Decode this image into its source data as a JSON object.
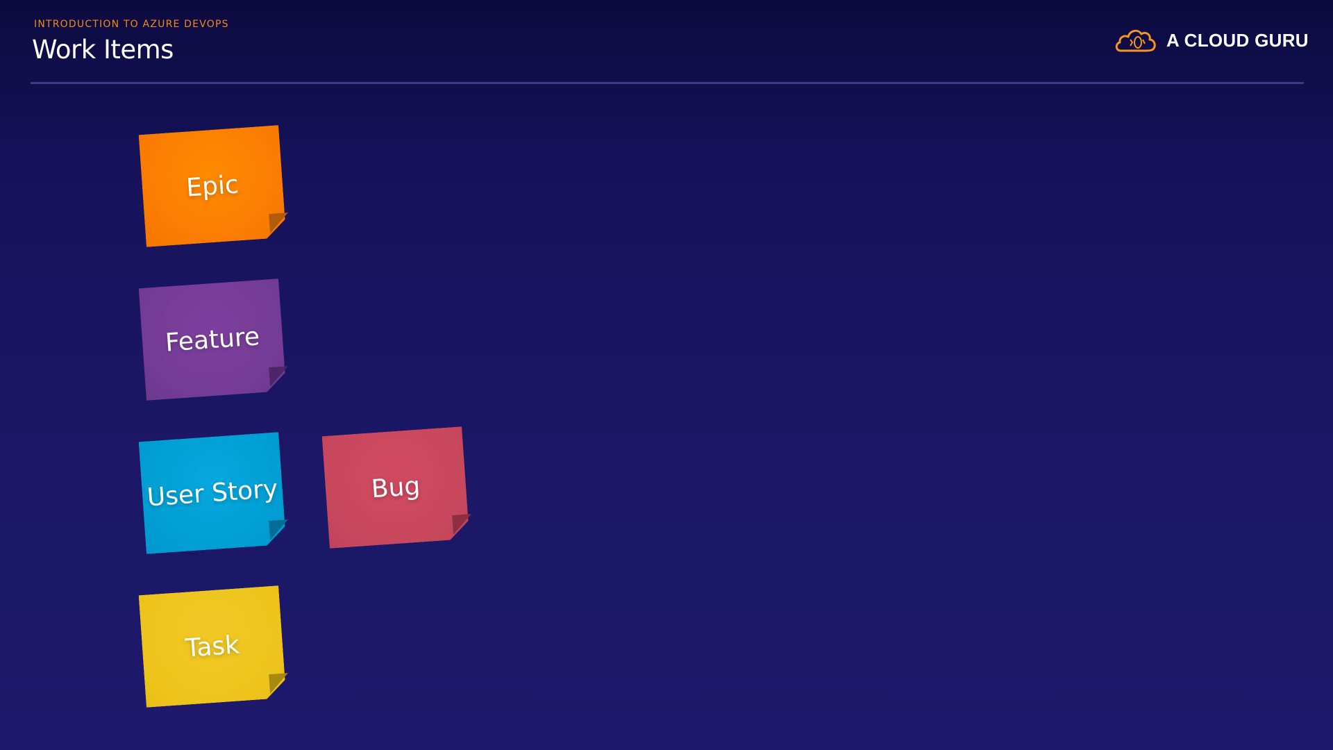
{
  "header": {
    "subtitle": "INTRODUCTION TO AZURE DEVOPS",
    "title": "Work Items"
  },
  "brand": {
    "logo_icon": "cloud-guru-logo-icon",
    "name": "A CLOUD GURU"
  },
  "work_items": [
    {
      "label": "Epic",
      "color": "#fb7c02"
    },
    {
      "label": "Feature",
      "color": "#743c95"
    },
    {
      "label": "User Story",
      "color": "#009ed3"
    },
    {
      "label": "Bug",
      "color": "#c8485e"
    },
    {
      "label": "Task",
      "color": "#eec51d"
    }
  ],
  "colors": {
    "accent": "#f08a1c",
    "background": "#1b1766"
  }
}
